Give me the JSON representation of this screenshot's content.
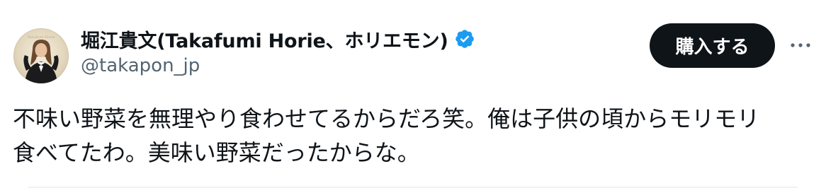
{
  "author": {
    "display_name": "堀江貴文(Takafumi Horie、ホリエモン)",
    "handle": "@takapon_jp",
    "verified": true,
    "verified_icon": "verified-badge-icon",
    "avatar_caption": "Takafumi Horie"
  },
  "actions": {
    "buy_label": "購入する",
    "more_icon": "more-horizontal-icon"
  },
  "tweet": {
    "lines": [
      "不味い野菜を無理やり食わせてるからだろ笑。俺は子供の頃からモリモリ",
      "食べてたわ。美味い野菜だったからな。"
    ]
  },
  "colors": {
    "text_primary": "#0f1419",
    "text_secondary": "#536471",
    "verified_blue": "#1d9bf0",
    "button_bg": "#0f1419",
    "button_text": "#ffffff"
  }
}
